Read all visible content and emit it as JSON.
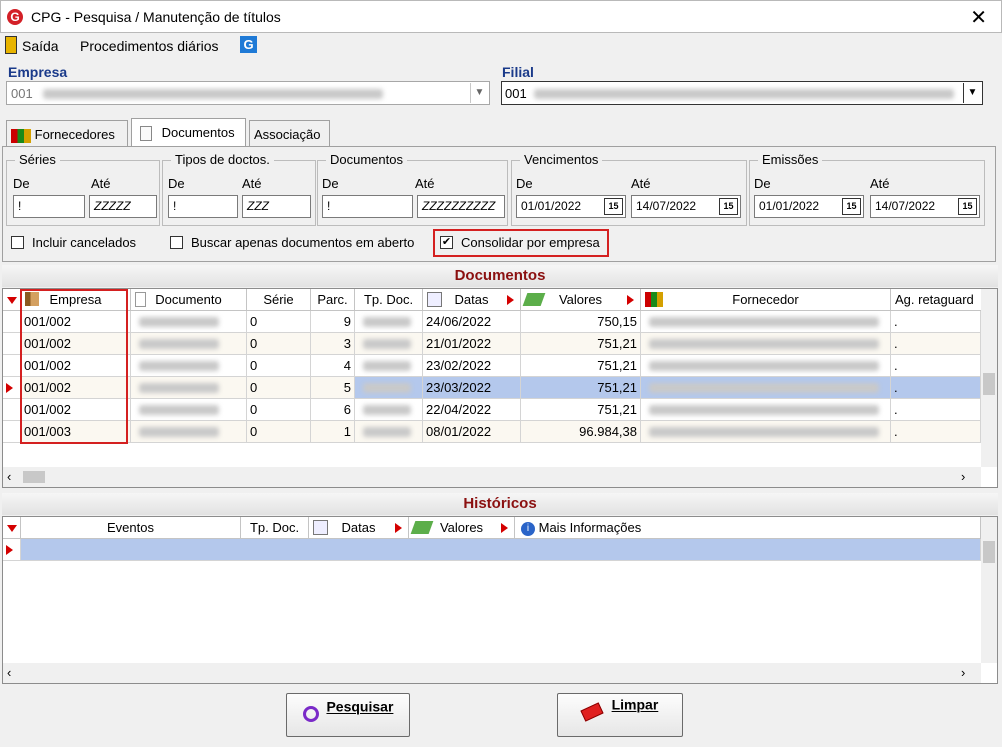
{
  "window": {
    "title": "CPG - Pesquisa / Manutenção de títulos"
  },
  "menu": {
    "exit": "Saída",
    "daily": "Procedimentos diários"
  },
  "empresa": {
    "label": "Empresa",
    "value": "001"
  },
  "filial": {
    "label": "Filial",
    "value": "001"
  },
  "tabs": [
    {
      "label": "Fornecedores"
    },
    {
      "label": "Documentos"
    },
    {
      "label": "Associação"
    }
  ],
  "filters": {
    "series": {
      "title": "Séries",
      "de_label": "De",
      "ate_label": "Até",
      "de": "!",
      "ate": "ZZZZZ"
    },
    "tipos": {
      "title": "Tipos de doctos.",
      "de_label": "De",
      "ate_label": "Até",
      "de": "!",
      "ate": "ZZZ"
    },
    "documentos": {
      "title": "Documentos",
      "de_label": "De",
      "ate_label": "Até",
      "de": "!",
      "ate": "ZZZZZZZZZZ"
    },
    "vencimentos": {
      "title": "Vencimentos",
      "de_label": "De",
      "ate_label": "Até",
      "de": "01/01/2022",
      "ate": "14/07/2022"
    },
    "emissoes": {
      "title": "Emissões",
      "de_label": "De",
      "ate_label": "Até",
      "de": "01/01/2022",
      "ate": "14/07/2022"
    },
    "cal_label": "15"
  },
  "checks": {
    "cancelados": {
      "label": "Incluir cancelados",
      "checked": false
    },
    "em_aberto": {
      "label": "Buscar apenas documentos em aberto",
      "checked": false
    },
    "consolidar": {
      "label": "Consolidar por empresa",
      "checked": true,
      "mark": "✔"
    }
  },
  "documentos": {
    "title": "Documentos",
    "columns": [
      "Empresa",
      "Documento",
      "Série",
      "Parc.",
      "Tp. Doc.",
      "Datas",
      "Valores",
      "Fornecedor",
      "Ag. retaguard"
    ],
    "rows": [
      {
        "empresa": "001/002",
        "serie": "0",
        "parc": "9",
        "data": "24/06/2022",
        "valor": "750,15",
        "ag": "."
      },
      {
        "empresa": "001/002",
        "serie": "0",
        "parc": "3",
        "data": "21/01/2022",
        "valor": "751,21",
        "ag": "."
      },
      {
        "empresa": "001/002",
        "serie": "0",
        "parc": "4",
        "data": "23/02/2022",
        "valor": "751,21",
        "ag": "."
      },
      {
        "empresa": "001/002",
        "serie": "0",
        "parc": "5",
        "data": "23/03/2022",
        "valor": "751,21",
        "ag": "."
      },
      {
        "empresa": "001/002",
        "serie": "0",
        "parc": "6",
        "data": "22/04/2022",
        "valor": "751,21",
        "ag": "."
      },
      {
        "empresa": "001/003",
        "serie": "0",
        "parc": "1",
        "data": "08/01/2022",
        "valor": "96.984,38",
        "ag": "."
      }
    ]
  },
  "historicos": {
    "title": "Históricos",
    "columns": [
      "Eventos",
      "Tp. Doc.",
      "Datas",
      "Valores",
      "Mais Informações"
    ]
  },
  "buttons": {
    "search": "Pesquisar",
    "clear": "Limpar"
  },
  "colors": {
    "accent": "#1a3a8a",
    "section": "#8b1010",
    "highlight": "#b4c8ec",
    "annotation": "#d42020"
  }
}
